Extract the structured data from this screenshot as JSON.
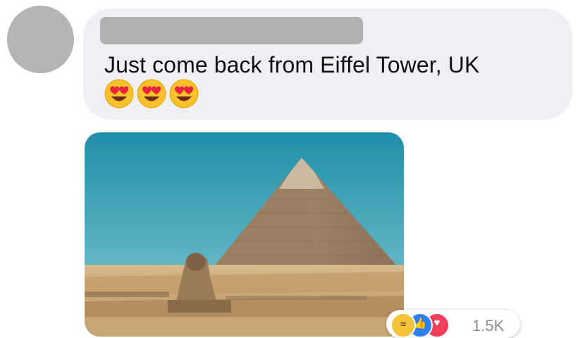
{
  "comment": {
    "text": "Just come back from Eiffel Tower, UK",
    "emojis": [
      "smiling-face-with-heart-eyes",
      "smiling-face-with-heart-eyes",
      "smiling-face-with-heart-eyes"
    ]
  },
  "reactions": {
    "types": [
      "haha",
      "like",
      "love"
    ],
    "count": "1.5K"
  },
  "colors": {
    "bubble_background": "#eef0f3",
    "avatar_placeholder": "#b5b5b5",
    "like_blue": "#2d7ff5",
    "love_red": "#f03e5b",
    "haha_yellow": "#f5c33b"
  }
}
